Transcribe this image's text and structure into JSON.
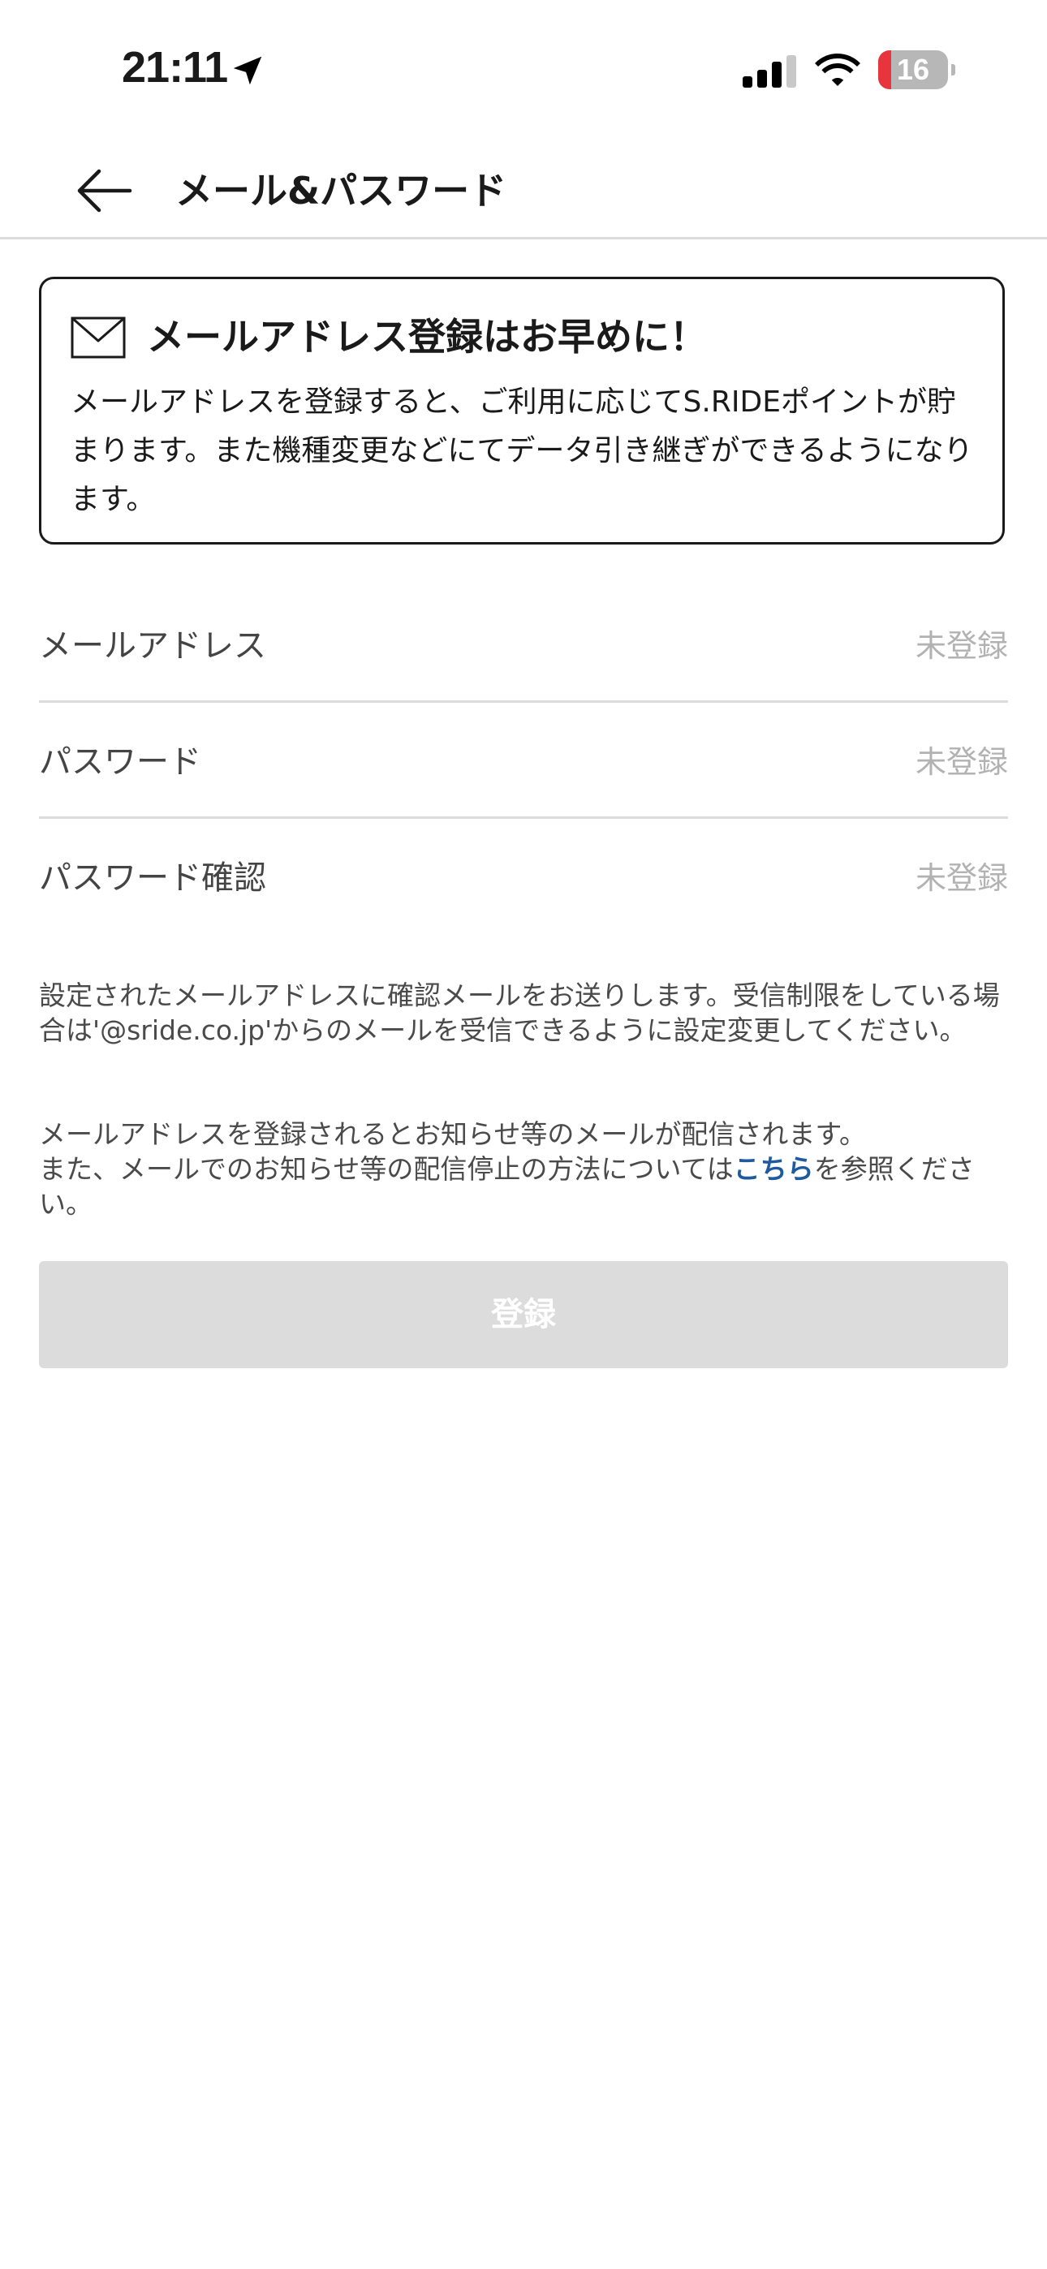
{
  "status_bar": {
    "time": "21:11",
    "battery_level": "16",
    "icons": [
      "location-arrow-icon",
      "cellular-signal-icon",
      "wifi-icon",
      "battery-icon"
    ]
  },
  "header": {
    "back_icon": "arrow-left-icon",
    "title": "メール&パスワード"
  },
  "notice": {
    "icon": "envelope-icon",
    "title": "メールアドレス登録はお早めに！",
    "body": "メールアドレスを登録すると、ご利用に応じてS.RIDEポイントが貯まります。また機種変更などにてデータ引き継ぎができるようになります。"
  },
  "form": {
    "rows": [
      {
        "label": "メールアドレス",
        "value": "未登録"
      },
      {
        "label": "パスワード",
        "value": "未登録"
      },
      {
        "label": "パスワード確認",
        "value": "未登録"
      }
    ]
  },
  "info": {
    "confirm_text": "設定されたメールアドレスに確認メールをお送りします。受信制限をしている場合は'@sride.co.jp'からのメールを受信できるように設定変更してください。",
    "notice_line1": "メールアドレスを登録されるとお知らせ等のメールが配信されます。",
    "notice_line2_prefix": "また、メールでのお知らせ等の配信停止の方法については",
    "notice_link": "こちら",
    "notice_line2_suffix": "を参照ください。"
  },
  "register_button": {
    "label": "登録",
    "state": "disabled"
  },
  "colors": {
    "link": "#1e5aa0",
    "battery_low": "#e8343c",
    "button_disabled": "#dcdcdc",
    "placeholder": "#b2b2b2"
  }
}
